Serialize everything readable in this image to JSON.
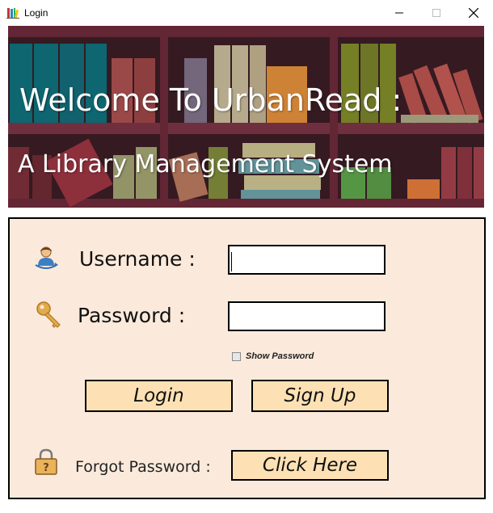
{
  "window": {
    "title": "Login",
    "icons": {
      "app": "books-app-icon",
      "minimize": "minimize-icon",
      "maximize": "maximize-icon",
      "close": "close-icon"
    }
  },
  "banner": {
    "title": "Welcome To UrbanRead :",
    "subtitle": "A Library Management System"
  },
  "login": {
    "username_label": "Username :",
    "username_value": "",
    "password_label": "Password :",
    "password_value": "",
    "show_password_label": "Show Password",
    "show_password_checked": false,
    "login_button": "Login",
    "signup_button": "Sign Up"
  },
  "forgot": {
    "label": "Forgot Password :",
    "button": "Click Here"
  },
  "colors": {
    "panel_bg": "#fbeadb",
    "button_bg": "#fde1b4",
    "border": "#000000"
  }
}
